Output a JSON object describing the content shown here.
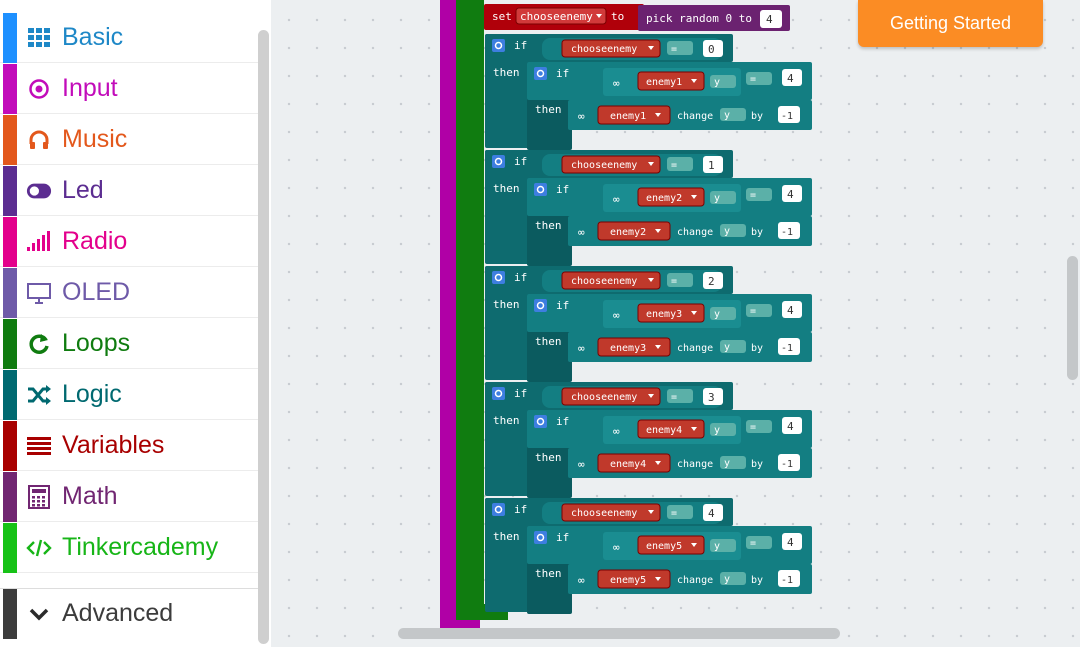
{
  "toolbox": {
    "categories": [
      {
        "label": "Basic",
        "color": "#1e90ff",
        "text_color": "#1e88c7",
        "icon": "grid-icon"
      },
      {
        "label": "Input",
        "color": "#c20cba",
        "text_color": "#c20cba",
        "icon": "radio-target-icon"
      },
      {
        "label": "Music",
        "color": "#e3581c",
        "text_color": "#e3581c",
        "icon": "headphones-icon"
      },
      {
        "label": "Led",
        "color": "#5c2d91",
        "text_color": "#5c2d91",
        "icon": "toggle-icon"
      },
      {
        "label": "Radio",
        "color": "#e3008c",
        "text_color": "#e3008c",
        "icon": "signal-bars-icon"
      },
      {
        "label": "OLED",
        "color": "#6e5aa8",
        "text_color": "#6e5aa8",
        "icon": "monitor-icon"
      },
      {
        "label": "Loops",
        "color": "#107c10",
        "text_color": "#107c10",
        "icon": "refresh-icon"
      },
      {
        "label": "Logic",
        "color": "#006970",
        "text_color": "#006970",
        "icon": "shuffle-icon"
      },
      {
        "label": "Variables",
        "color": "#a80000",
        "text_color": "#a80000",
        "icon": "lines-icon"
      },
      {
        "label": "Math",
        "color": "#712672",
        "text_color": "#712672",
        "icon": "calculator-icon"
      },
      {
        "label": "Tinkercademy",
        "color": "#17c217",
        "text_color": "#17b517",
        "icon": "code-icon"
      }
    ],
    "advanced": {
      "label": "Advanced",
      "color": "#3c3c3c",
      "icon": "chevron-down-icon"
    }
  },
  "header": {
    "getting_started": "Getting Started"
  },
  "blocks": {
    "set_keyword": "set",
    "set_variable": "chooseenemy",
    "to_keyword": "to",
    "random_text": "pick random 0 to",
    "random_max": "4",
    "if_keyword": "if",
    "then_keyword": "then",
    "change_keyword": "change",
    "by_keyword": "by",
    "eq_op": "=",
    "axis": "y",
    "threshold": "4",
    "delta": "-1",
    "branches": [
      {
        "index": "0",
        "sprite": "enemy1"
      },
      {
        "index": "1",
        "sprite": "enemy2"
      },
      {
        "index": "2",
        "sprite": "enemy3"
      },
      {
        "index": "3",
        "sprite": "enemy4"
      },
      {
        "index": "4",
        "sprite": "enemy5"
      }
    ]
  },
  "colors": {
    "loop_block": "#107c10",
    "outer_block": "#b000a6",
    "logic_block": "#0e6b6f",
    "logic_inner": "#137e82",
    "variable_block": "#a80000",
    "math_block": "#6b2270",
    "workspace_bg": "#eceff1"
  }
}
